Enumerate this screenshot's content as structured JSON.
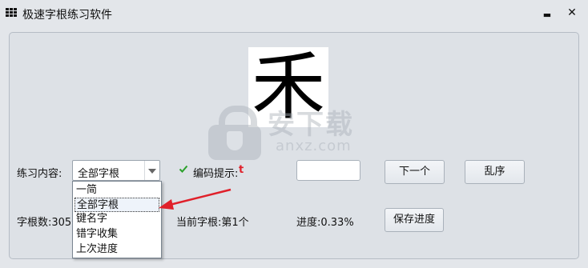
{
  "window": {
    "title": "极速字根练习软件",
    "minimize_glyph": "▬",
    "close_glyph": "✕"
  },
  "character": "禾",
  "watermark": {
    "text": "安下载",
    "sub": "anxz.com"
  },
  "practice": {
    "label": "练习内容:",
    "selected": "全部字根",
    "options": [
      "一简",
      "全部字根",
      "键名字",
      "错字收集",
      "上次进度"
    ]
  },
  "hint": {
    "label": "编码提示:",
    "value": "t"
  },
  "buttons": {
    "next": "下一个",
    "shuffle": "乱序",
    "save": "保存进度"
  },
  "status": {
    "count": "字根数:305个",
    "current": "当前字根:第1个",
    "progress": "进度:0.33%"
  },
  "colors": {
    "hint_value": "#e0202a",
    "arrow": "#e0202a",
    "check": "#2aa02a"
  }
}
